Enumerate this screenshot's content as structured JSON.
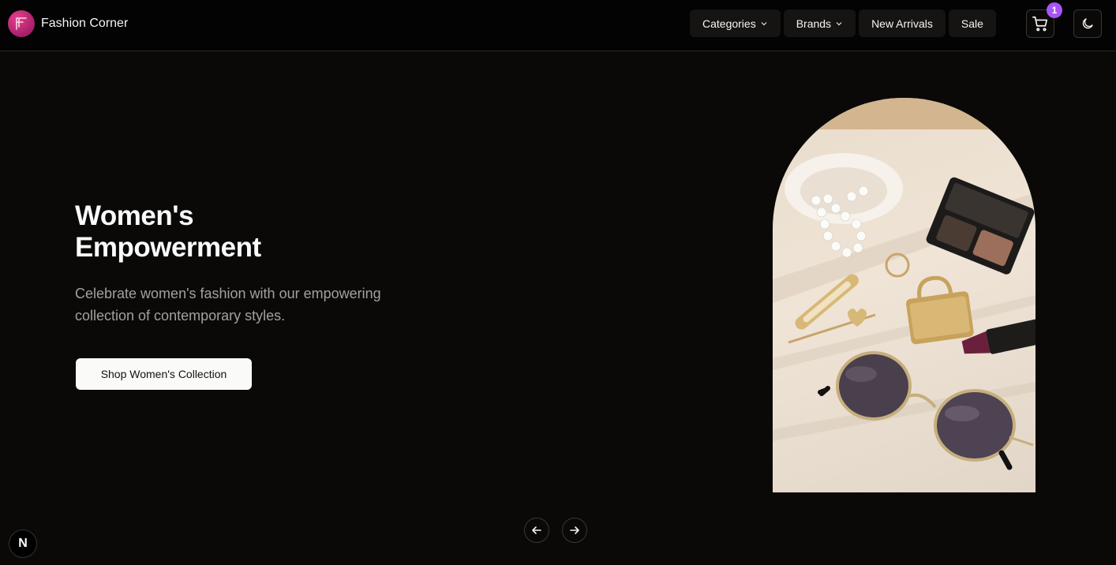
{
  "header": {
    "brand_name": "Fashion Corner",
    "nav": [
      {
        "label": "Categories",
        "has_dropdown": true
      },
      {
        "label": "Brands",
        "has_dropdown": true
      },
      {
        "label": "New Arrivals",
        "has_dropdown": false
      },
      {
        "label": "Sale",
        "has_dropdown": false
      }
    ],
    "cart_count": "1",
    "icons": {
      "cart": "cart-icon",
      "theme": "moon-icon"
    }
  },
  "hero": {
    "title_line1": "Women's",
    "title_line2": "Empowerment",
    "subtitle": "Celebrate women's fashion with our empowering collection of contemporary styles.",
    "cta_label": "Shop Women's Collection"
  },
  "floating_badge": "N",
  "colors": {
    "background": "#0a0908",
    "accent": "#a855f7",
    "cta_bg": "#fafaf9"
  }
}
